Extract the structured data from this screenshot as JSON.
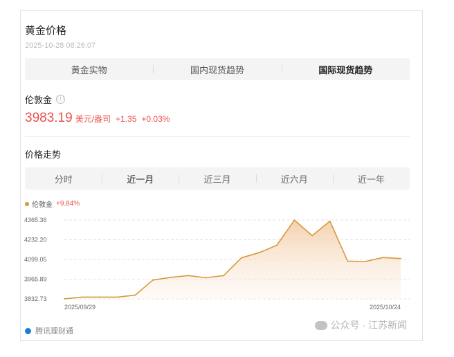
{
  "header": {
    "title": "黄金价格",
    "timestamp": "2025-10-28 08:26:07"
  },
  "tabs": [
    {
      "label": "黄金实物"
    },
    {
      "label": "国内现货趋势"
    },
    {
      "label": "国际现货趋势"
    }
  ],
  "active_tab": 2,
  "quote": {
    "name": "伦敦金",
    "info_icon": "ⓘ",
    "price": "3983.19",
    "unit": "美元/盎司",
    "change": "+1.35",
    "change_pct": "+0.03%"
  },
  "trend": {
    "title": "价格走势"
  },
  "periods": [
    {
      "label": "分时"
    },
    {
      "label": "近一月"
    },
    {
      "label": "近三月"
    },
    {
      "label": "近六月"
    },
    {
      "label": "近一年"
    }
  ],
  "active_period": 1,
  "legend": {
    "series": "伦敦金",
    "pct": "+9.84%"
  },
  "colors": {
    "accent_red": "#e8504a",
    "line": "#d59a3d",
    "fill": "#f6d9bd"
  },
  "chart_data": {
    "type": "area",
    "y_ticks": [
      "4365.36",
      "4232.20",
      "4099.05",
      "3965.89",
      "3832.73"
    ],
    "ylim": [
      3832.73,
      4365.36
    ],
    "x_start_label": "2025/09/29",
    "x_end_label": "2025/10/24",
    "series": [
      {
        "values": [
          3833,
          3845,
          3845,
          3845,
          3858,
          3960,
          3978,
          3990,
          3975,
          3990,
          4110,
          4145,
          4195,
          4365,
          4260,
          4358,
          4088,
          4085,
          4112,
          4105
        ]
      }
    ],
    "grid": true,
    "legend": "top-left"
  },
  "footer": {
    "source": "腾讯理财通"
  },
  "watermark": {
    "text": "公众号 · 江苏新闻"
  }
}
